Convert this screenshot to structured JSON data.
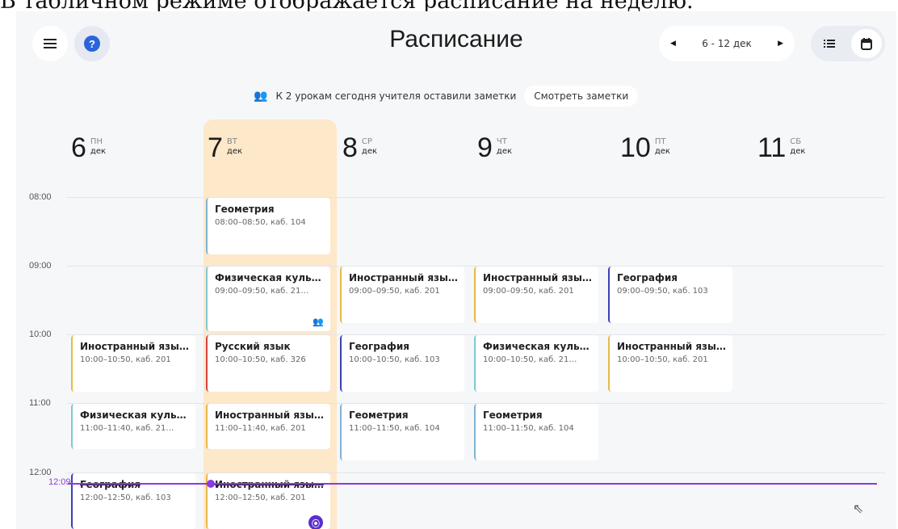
{
  "caption": "В табличном режиме отображается расписание на неделю.",
  "header": {
    "title": "Расписание",
    "week_range": "6 - 12 дек"
  },
  "notice": {
    "text": "К 2 урокам сегодня учителя оставили заметки",
    "button_label": "Смотреть заметки"
  },
  "days": [
    {
      "num": "6",
      "weekday": "ПН",
      "month": "дек"
    },
    {
      "num": "7",
      "weekday": "ВТ",
      "month": "дек"
    },
    {
      "num": "8",
      "weekday": "СР",
      "month": "дек"
    },
    {
      "num": "9",
      "weekday": "ЧТ",
      "month": "дек"
    },
    {
      "num": "10",
      "weekday": "ПТ",
      "month": "дек"
    },
    {
      "num": "11",
      "weekday": "СБ",
      "month": "дек"
    }
  ],
  "times": [
    "08:00",
    "09:00",
    "10:00",
    "11:00",
    "12:00"
  ],
  "now_time": "12:09",
  "lessons": {
    "geom_tue": {
      "title": "Геометрия",
      "info": "08:00–08:50, каб. 104"
    },
    "pe_tue": {
      "title": "Физическая культ…",
      "info": "09:00–09:50, каб. 21…"
    },
    "eng_wed_9": {
      "title": "Иностранный язы…",
      "info": "09:00–09:50, каб. 201"
    },
    "eng_thu_9": {
      "title": "Иностранный язы…",
      "info": "09:00–09:50, каб. 201"
    },
    "geo_fri_9": {
      "title": "География",
      "info": "09:00–09:50, каб. 103"
    },
    "eng_mon_10": {
      "title": "Иностранный язы…",
      "info": "10:00–10:50, каб. 201"
    },
    "rus_tue_10": {
      "title": "Русский язык",
      "info": "10:00–10:50, каб. 326"
    },
    "geo_wed_10": {
      "title": "География",
      "info": "10:00–10:50, каб. 103"
    },
    "pe_thu_10": {
      "title": "Физическая культ…",
      "info": "10:00–10:50, каб. 21…"
    },
    "eng_fri_10": {
      "title": "Иностранный язы…",
      "info": "10:00–10:50, каб. 201"
    },
    "pe_mon_11": {
      "title": "Физическая культ…",
      "info": "11:00–11:40, каб. 21…"
    },
    "eng_tue_11": {
      "title": "Иностранный язы…",
      "info": "11:00–11:40, каб. 201"
    },
    "geom_wed_11": {
      "title": "Геометрия",
      "info": "11:00–11:50, каб. 104"
    },
    "geom_thu_11": {
      "title": "Геометрия",
      "info": "11:00–11:50, каб. 104"
    },
    "geo_mon_12": {
      "title": "География",
      "info": "12:00–12:50, каб. 103"
    },
    "eng_tue_12": {
      "title": "Иностранный язы…",
      "info": "12:00–12:50, каб. 201"
    }
  },
  "colors": {
    "today_bg": "#fde8c9",
    "now_line": "#8a3be0",
    "geometry": "#7fb3d5",
    "pe": "#7fc8d4",
    "foreign": "#e6b94a",
    "geography": "#3c3fb8",
    "russian": "#d44545"
  },
  "icons": [
    "menu-icon",
    "help-icon",
    "chevron-left-icon",
    "chevron-right-icon",
    "list-view-icon",
    "calendar-view-icon",
    "teacher-note-icon"
  ]
}
